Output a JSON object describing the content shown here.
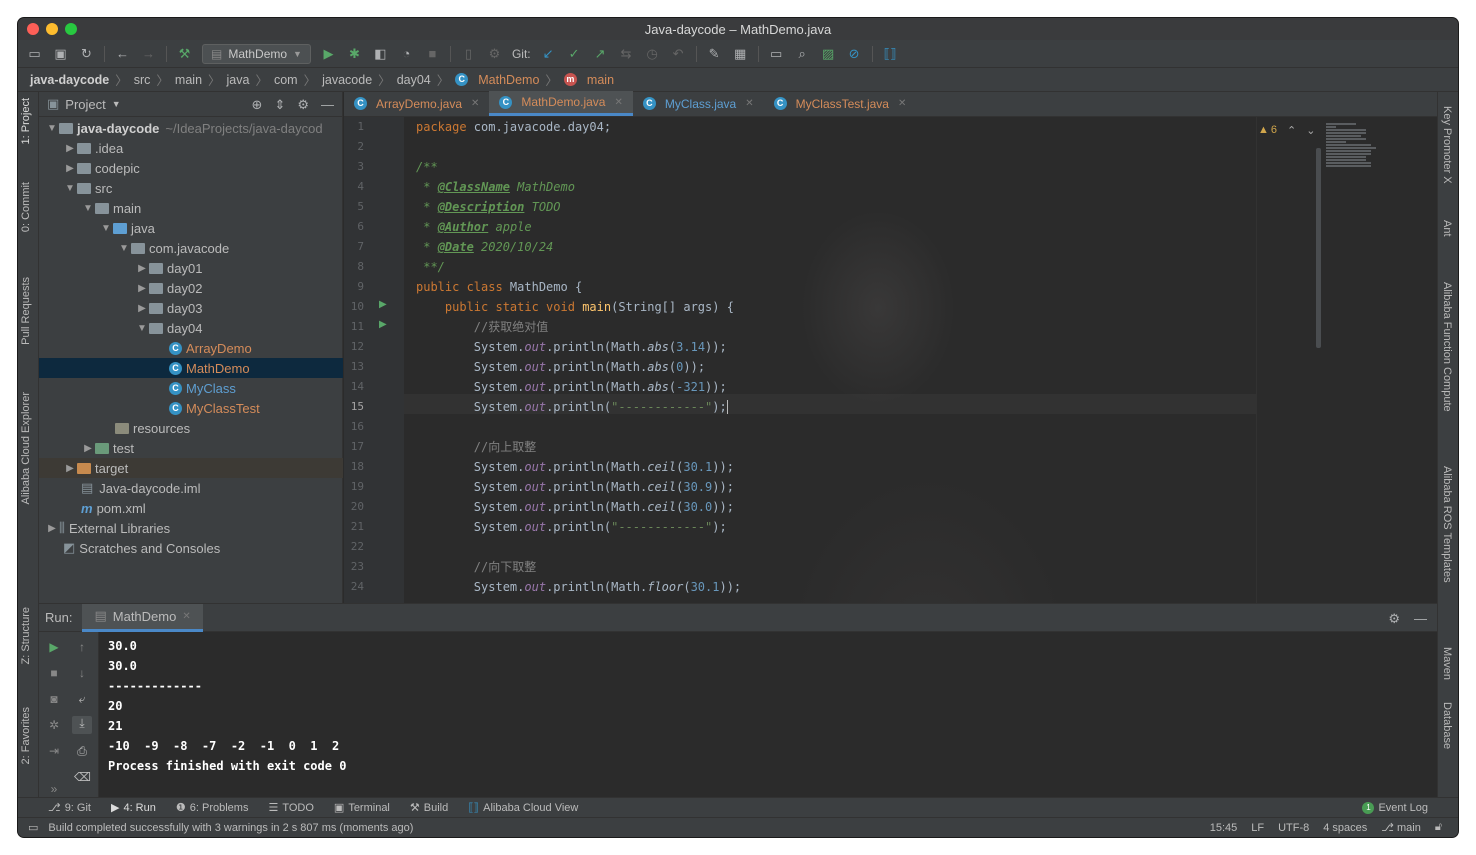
{
  "window": {
    "title": "Java-daycode – MathDemo.java"
  },
  "toolbar": {
    "run_config": "MathDemo",
    "git_label": "Git:"
  },
  "breadcrumb": [
    "java-daycode",
    "src",
    "main",
    "java",
    "com",
    "javacode",
    "day04",
    "MathDemo",
    "main"
  ],
  "left_strip": {
    "tabs": [
      "1: Project",
      "0: Commit",
      "Pull Requests",
      "Alibaba Cloud Explorer",
      "Z: Structure",
      "2: Favorites"
    ]
  },
  "right_strip": {
    "tabs": [
      "Key Promoter X",
      "Ant",
      "Alibaba Function Compute",
      "Alibaba ROS Templates",
      "Maven",
      "Database"
    ]
  },
  "project": {
    "title": "Project",
    "root_label": "java-daycode",
    "root_path": "~/IdeaProjects/java-daycod",
    "items": {
      "idea": ".idea",
      "codepic": "codepic",
      "src": "src",
      "main": "main",
      "java": "java",
      "pkg": "com.javacode",
      "day01": "day01",
      "day02": "day02",
      "day03": "day03",
      "day04": "day04",
      "array_demo": "ArrayDemo",
      "math_demo": "MathDemo",
      "my_class": "MyClass",
      "my_class_test": "MyClassTest",
      "resources": "resources",
      "test": "test",
      "target": "target",
      "iml": "Java-daycode.iml",
      "pom": "pom.xml",
      "ext_libs": "External Libraries",
      "scratches": "Scratches and Consoles"
    }
  },
  "editor": {
    "tabs": [
      {
        "label": "ArrayDemo.java",
        "active": false
      },
      {
        "label": "MathDemo.java",
        "active": true
      },
      {
        "label": "MyClass.java",
        "active": false
      },
      {
        "label": "MyClassTest.java",
        "active": false
      }
    ],
    "line_numbers": [
      "1",
      "2",
      "3",
      "4",
      "5",
      "6",
      "7",
      "8",
      "9",
      "10",
      "11",
      "12",
      "13",
      "14",
      "15",
      "16",
      "17",
      "18",
      "19",
      "20",
      "21",
      "22",
      "23",
      "24"
    ],
    "current_line": "15",
    "warnings_count": "6",
    "code": {
      "l1_kw": "package",
      "l1_rest": " com.javacode.day04;",
      "l3": "/**",
      "l4_tag": "@ClassName",
      "l4_rest": " MathDemo",
      "l5_tag": "@Description",
      "l5_rest": " TODO",
      "l6_tag": "@Author",
      "l6_rest": " apple",
      "l7_tag": "@Date",
      "l7_rest": " 2020/10/24",
      "l8": " **/",
      "l9_kw": "public class",
      "l9_rest": " MathDemo {",
      "l10_kw": "public static void",
      "l10_mth": "main",
      "l10_rest": "(String[] args) {",
      "c_abs": "//获取绝对值",
      "c_ceil": "//向上取整",
      "c_floor": "//向下取整",
      "sys": "System.",
      "out": "out",
      "println": ".println(",
      "math": "Math.",
      "abs": "abs",
      "ceil": "ceil",
      "floor": "floor",
      "n_314": "3.14",
      "n_0": "0",
      "n_321": "-321",
      "n_301": "30.1",
      "n_309": "30.9",
      "n_300": "30.0",
      "dashes": "\"------------\"",
      "close": "));",
      "close_str": ");"
    }
  },
  "run": {
    "label": "Run:",
    "tab": "MathDemo",
    "output": [
      "30.0",
      "30.0",
      "-------------",
      "20",
      "21",
      "-10  -9  -8  -7  -2  -1  0  1  2",
      "Process finished with exit code 0"
    ]
  },
  "bottom_tabs": [
    "9: Git",
    "4: Run",
    "6: Problems",
    "TODO",
    "Terminal",
    "Build",
    "Alibaba Cloud View"
  ],
  "event_log": {
    "count": "1",
    "label": "Event Log"
  },
  "status": {
    "message": "Build completed successfully with 3 warnings in 2 s 807 ms (moments ago)",
    "position": "15:45",
    "line_sep": "LF",
    "encoding": "UTF-8",
    "indent": "4 spaces",
    "branch": "main"
  },
  "colors": {
    "accent": "#4a88c7",
    "run_green": "#59a869",
    "keyword": "#cc7832",
    "string": "#6a8759",
    "number": "#6897bb",
    "doc": "#629755"
  }
}
